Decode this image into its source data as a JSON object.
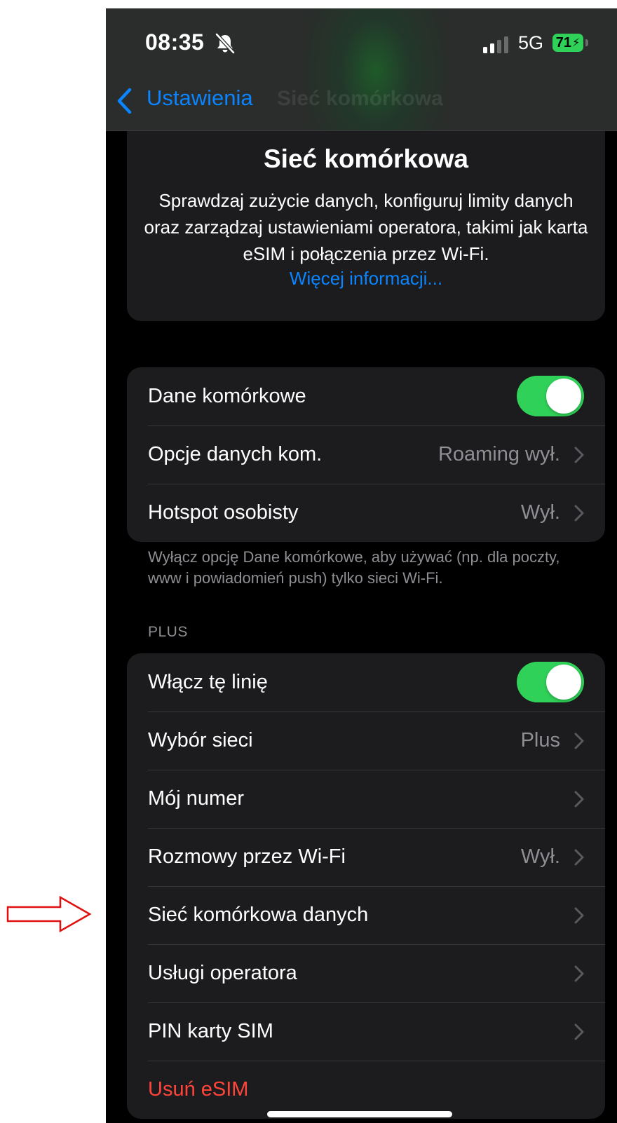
{
  "status_bar": {
    "time": "08:35",
    "network": "5G",
    "battery": "71"
  },
  "nav": {
    "back_label": "Ustawienia",
    "title": "Sieć komórkowa"
  },
  "info": {
    "title": "Sieć komórkowa",
    "description": "Sprawdzaj zużycie danych, konfiguruj limity danych oraz zarządzaj ustawieniami operatora, takimi jak karta eSIM i połączenia przez Wi-Fi.",
    "link": "Więcej informacji..."
  },
  "cellular_group": {
    "rows": [
      {
        "label": "Dane komórkowe",
        "toggle_on": true
      },
      {
        "label": "Opcje danych kom.",
        "value": "Roaming wył."
      },
      {
        "label": "Hotspot osobisty",
        "value": "Wył."
      }
    ],
    "footer": "Wyłącz opcję Dane komórkowe, aby używać (np. dla poczty, www i powiadomień push) tylko sieci Wi-Fi."
  },
  "plus_group": {
    "header": "PLUS",
    "rows": [
      {
        "label": "Włącz tę linię",
        "toggle_on": true
      },
      {
        "label": "Wybór sieci",
        "value": "Plus"
      },
      {
        "label": "Mój numer",
        "value": ""
      },
      {
        "label": "Rozmowy przez Wi-Fi",
        "value": "Wył."
      },
      {
        "label": "Sieć komórkowa danych",
        "value": ""
      },
      {
        "label": "Usługi operatora",
        "value": ""
      },
      {
        "label": "PIN karty SIM",
        "value": ""
      },
      {
        "label": "Usuń eSIM"
      }
    ]
  },
  "colors": {
    "accent": "#0a84ff",
    "toggle_on": "#30d158",
    "danger": "#ff453a",
    "annotation": "#e01010"
  }
}
